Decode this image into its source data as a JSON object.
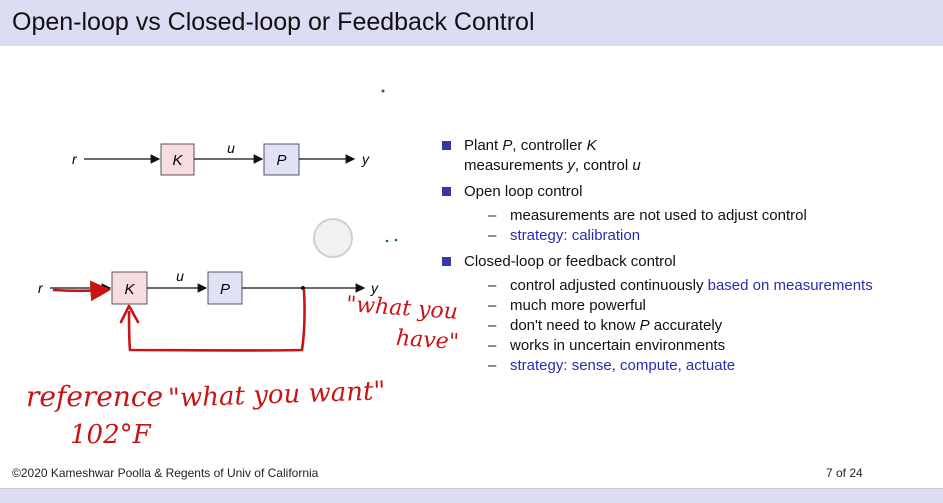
{
  "slide": {
    "title": "Open-loop vs Closed-loop or Feedback Control",
    "footer_copyright": "©2020 Kameshwar Poolla & Regents of Univ of California",
    "page_number": "7 of 24"
  },
  "diagram_open": {
    "input_label": "r",
    "controller_label": "K",
    "signal_label": "u",
    "plant_label": "P",
    "output_label": "y"
  },
  "diagram_closed": {
    "input_label": "r",
    "controller_label": "K",
    "signal_label": "u",
    "plant_label": "P",
    "output_label": "y"
  },
  "bullets": {
    "b1_line1_pre": "Plant ",
    "b1_P": "P",
    "b1_line1_mid": ", controller ",
    "b1_K": "K",
    "b1_line2_pre": "measurements ",
    "b1_y": "y",
    "b1_line2_mid": ", control ",
    "b1_u": "u",
    "b2": "Open loop control",
    "b2_sub1": "measurements are not used to adjust control",
    "b2_sub2_a": "strategy",
    "b2_sub2_b": ": calibration",
    "b3": "Closed-loop or feedback control",
    "b3_sub1_a": "control adjusted continuously ",
    "b3_sub1_b": "based on measurements",
    "b3_sub2": "much more powerful",
    "b3_sub3_a": "don't need to know ",
    "b3_sub3_P": "P",
    "b3_sub3_b": " accurately",
    "b3_sub4": "works in uncertain environments",
    "b3_sub5_a": "strategy",
    "b3_sub5_b": ": sense, compute, actuate"
  },
  "annotations": {
    "what_you_have_line1": "\"what you",
    "what_you_have_line2": "have\"",
    "reference": "reference",
    "what_you_want": "\"what you want\"",
    "temperature": "102°F"
  },
  "colors": {
    "title_bar": "#dcdcf2",
    "bullet": "#3636a8",
    "link_blue": "#2b2bb0",
    "ink_red": "#c81414",
    "controller_fill": "#f7dde2",
    "plant_fill": "#e2e2f6"
  }
}
